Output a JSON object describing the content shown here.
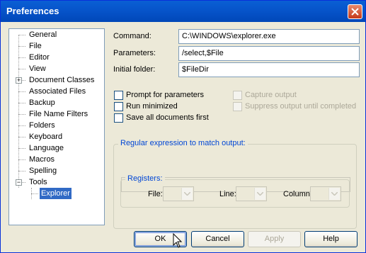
{
  "window": {
    "title": "Preferences"
  },
  "tree": {
    "items": [
      {
        "label": "General"
      },
      {
        "label": "File"
      },
      {
        "label": "Editor"
      },
      {
        "label": "View"
      },
      {
        "label": "Document Classes"
      },
      {
        "label": "Associated Files"
      },
      {
        "label": "Backup"
      },
      {
        "label": "File Name Filters"
      },
      {
        "label": "Folders"
      },
      {
        "label": "Keyboard"
      },
      {
        "label": "Language"
      },
      {
        "label": "Macros"
      },
      {
        "label": "Spelling"
      },
      {
        "label": "Tools"
      }
    ],
    "child": {
      "label": "Explorer",
      "selected": true
    }
  },
  "form": {
    "command_label": "Command:",
    "command_value": "C:\\WINDOWS\\explorer.exe",
    "parameters_label": "Parameters:",
    "parameters_value": "/select,$File",
    "folder_label": "Initial folder:",
    "folder_value": "$FileDir"
  },
  "options": {
    "prompt": "Prompt for parameters",
    "minimized": "Run minimized",
    "save_all": "Save all documents first",
    "capture": "Capture output",
    "suppress": "Suppress output until completed"
  },
  "regex_group": {
    "title": "Regular expression to match output:",
    "registers_title": "Registers:",
    "file_label": "File:",
    "line_label": "Line:",
    "column_label": "Column:"
  },
  "buttons": {
    "ok": "OK",
    "cancel": "Cancel",
    "apply": "Apply",
    "help": "Help"
  },
  "colors": {
    "title_bar": "#0a5fd4",
    "selection": "#316ac5",
    "group_title": "#0046d5"
  }
}
